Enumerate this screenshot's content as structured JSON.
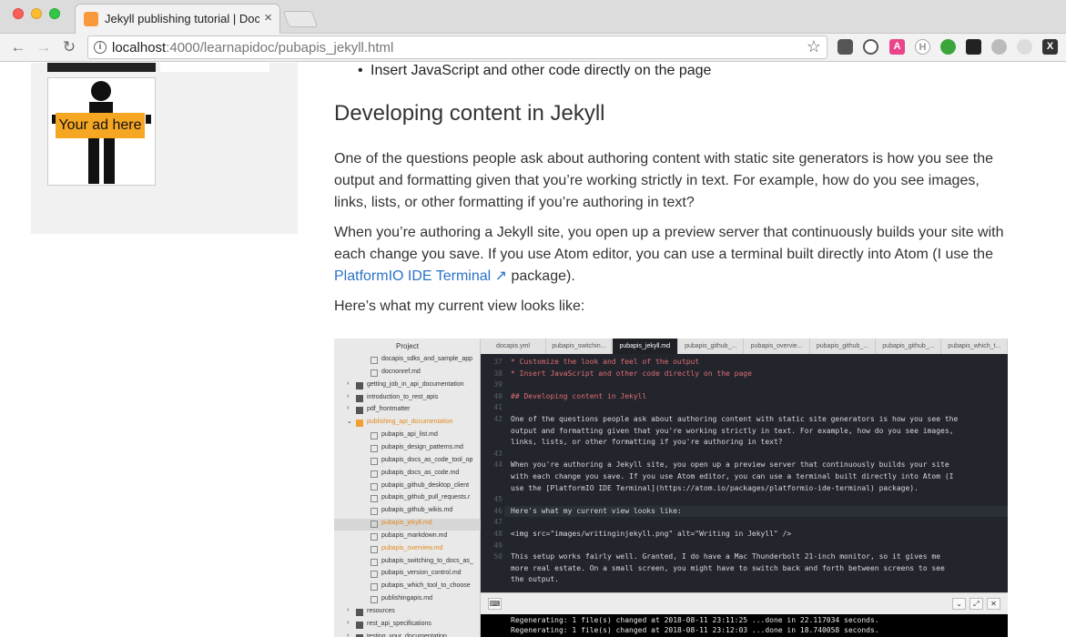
{
  "browser": {
    "tab_title": "Jekyll publishing tutorial | Doc",
    "tab_close": "×",
    "url_host": "localhost",
    "url_rest": ":4000/learnapidoc/pubapis_jekyll.html",
    "back": "←",
    "forward": "→",
    "reload": "↻",
    "star": "☆",
    "info": "i"
  },
  "sidebar": {
    "ad_text": "Your ad here"
  },
  "article": {
    "bullet": "Insert JavaScript and other code directly on the page",
    "heading": "Developing content in Jekyll",
    "para1": "One of the questions people ask about authoring content with static site generators is how you see the output and formatting given that you’re working strictly in text. For example, how do you see images, links, lists, or other formatting if you’re authoring in text?",
    "para2_start": "When you’re authoring a Jekyll site, you open up a preview server that continuously builds your site with each change you save. If you use Atom editor, you can use a terminal built directly into Atom (I use the ",
    "para2_link": "PlatformIO IDE Terminal",
    "para2_end": " package).",
    "para3": "Here’s what my current view looks like:"
  },
  "editor": {
    "tree_header": "Project",
    "tree_items": [
      {
        "label": "docapis_sdks_and_sample_app",
        "type": "file",
        "indent": 2
      },
      {
        "label": "docnonref.md",
        "type": "file",
        "indent": 2
      },
      {
        "label": "getting_job_in_api_documentation",
        "type": "folder",
        "indent": 1
      },
      {
        "label": "introduction_to_rest_apis",
        "type": "folder",
        "indent": 1
      },
      {
        "label": "pdf_frontmatter",
        "type": "folder",
        "indent": 1
      },
      {
        "label": "publishing_api_documentation",
        "type": "folder-open",
        "indent": 1
      },
      {
        "label": "pubapis_api_list.md",
        "type": "file",
        "indent": 2
      },
      {
        "label": "pubapis_design_patterns.md",
        "type": "file",
        "indent": 2
      },
      {
        "label": "pubapis_docs_as_code_tool_op",
        "type": "file",
        "indent": 2
      },
      {
        "label": "pubapis_docs_as_code.md",
        "type": "file",
        "indent": 2
      },
      {
        "label": "pubapis_github_desktop_client",
        "type": "file",
        "indent": 2
      },
      {
        "label": "pubapis_github_pull_requests.r",
        "type": "file",
        "indent": 2
      },
      {
        "label": "pubapis_github_wikis.md",
        "type": "file",
        "indent": 2
      },
      {
        "label": "pubapis_jekyll.md",
        "type": "file-selected",
        "indent": 2
      },
      {
        "label": "pubapis_markdown.md",
        "type": "file",
        "indent": 2
      },
      {
        "label": "pubapis_overview.md",
        "type": "file-modified",
        "indent": 2
      },
      {
        "label": "pubapis_switching_to_docs_as_",
        "type": "file",
        "indent": 2
      },
      {
        "label": "pubapis_version_control.md",
        "type": "file",
        "indent": 2
      },
      {
        "label": "pubapis_which_tool_to_choose",
        "type": "file",
        "indent": 2
      },
      {
        "label": "publishingapis.md",
        "type": "file",
        "indent": 2
      },
      {
        "label": "resources",
        "type": "folder",
        "indent": 1
      },
      {
        "label": "rest_api_specifications",
        "type": "folder",
        "indent": 1
      },
      {
        "label": "testing_your_documentation",
        "type": "folder",
        "indent": 1
      }
    ],
    "tabs": [
      {
        "label": "docapis.yml",
        "active": false
      },
      {
        "label": "pubapis_switchin...",
        "active": false
      },
      {
        "label": "pubapis_jekyll.md",
        "active": true
      },
      {
        "label": "pubapis_github_...",
        "active": false
      },
      {
        "label": "pubapis_overvie...",
        "active": false
      },
      {
        "label": "pubapis_github_...",
        "active": false
      },
      {
        "label": "pubapis_github_...",
        "active": false
      },
      {
        "label": "pubapis_which_t...",
        "active": false
      }
    ],
    "gutter": [
      "37",
      "38",
      "39",
      "40",
      "41",
      "42",
      "",
      "",
      "43",
      "44",
      "",
      "",
      "45",
      "46",
      "47",
      "48",
      "49",
      "50",
      "",
      ""
    ],
    "code": [
      {
        "text": "* Customize the look and feel of the output",
        "cls": "b"
      },
      {
        "text": "* Insert JavaScript and other code directly on the page",
        "cls": "b"
      },
      {
        "text": "",
        "cls": ""
      },
      {
        "text": "## Developing content in Jekyll",
        "cls": "h"
      },
      {
        "text": "",
        "cls": ""
      },
      {
        "text": "One of the questions people ask about authoring content with static site generators is how you see the",
        "cls": ""
      },
      {
        "text": "output and formatting given that you're working strictly in text. For example, how do you see images,",
        "cls": ""
      },
      {
        "text": "links, lists, or other formatting if you're authoring in text?",
        "cls": ""
      },
      {
        "text": "",
        "cls": ""
      },
      {
        "text": "When you're authoring a Jekyll site, you open up a preview server that continuously builds your site",
        "cls": ""
      },
      {
        "text": "with each change you save. If you use Atom editor, you can use a terminal built directly into Atom (I",
        "cls": ""
      },
      {
        "text": "use the [PlatformIO IDE Terminal](https://atom.io/packages/platformio-ide-terminal) package).",
        "cls": ""
      },
      {
        "text": "",
        "cls": ""
      },
      {
        "text": "Here's what my current view looks like:",
        "cls": ""
      },
      {
        "text": "",
        "cls": ""
      },
      {
        "text": "<img src=\"images/writinginjekyll.png\" alt=\"Writing in Jekyll\" />",
        "cls": ""
      },
      {
        "text": "",
        "cls": ""
      },
      {
        "text": "This setup works fairly well. Granted, I do have a Mac Thunderbolt 21-inch monitor, so it gives me",
        "cls": ""
      },
      {
        "text": "more real estate. On a small screen, you might have to switch back and forth between screens to see",
        "cls": ""
      },
      {
        "text": "the output.",
        "cls": ""
      }
    ],
    "terminal": [
      "Regenerating: 1 file(s) changed at 2018-08-11 23:11:25 ...done in 22.117034 seconds.",
      "Regenerating: 1 file(s) changed at 2018-08-11 23:12:03 ...done in 18.740058 seconds."
    ]
  }
}
